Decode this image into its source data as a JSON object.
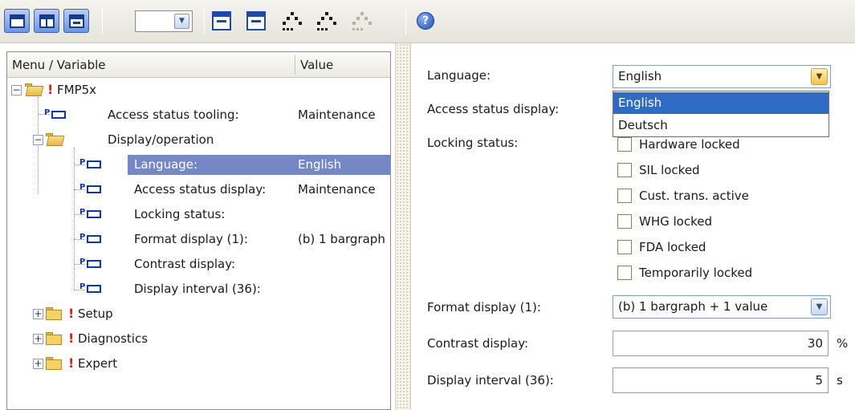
{
  "toolbar": {
    "buttons_left": [
      {
        "icon": "window-layout-icon"
      },
      {
        "icon": "window-split-icon"
      },
      {
        "icon": "window-panel-icon"
      }
    ],
    "combo_value": "",
    "icons_mid": [
      "window-icon",
      "window-icon",
      "network-icon",
      "network-icon",
      "network-disabled-icon"
    ],
    "help_glyph": "?"
  },
  "tree": {
    "columns": {
      "menu": "Menu / Variable",
      "value": "Value"
    },
    "rows": [
      {
        "label": "FMP5x",
        "value": "",
        "type": "folder-open",
        "warning": "!"
      },
      {
        "label": "Access status tooling:",
        "value": "Maintenance",
        "type": "param"
      },
      {
        "label": "Display/operation",
        "value": "",
        "type": "folder-open"
      },
      {
        "label": "Language:",
        "value": "English",
        "type": "param",
        "selected": true
      },
      {
        "label": "Access status display:",
        "value": "Maintenance",
        "type": "param"
      },
      {
        "label": "Locking status:",
        "value": "",
        "type": "param"
      },
      {
        "label": "Format display (1):",
        "value": "(b) 1 bargraph",
        "type": "param"
      },
      {
        "label": "Contrast display:",
        "value": "",
        "type": "param"
      },
      {
        "label": "Display interval (36):",
        "value": "",
        "type": "param"
      },
      {
        "label": "Setup",
        "value": "",
        "type": "folder-closed",
        "warning": "!"
      },
      {
        "label": "Diagnostics",
        "value": "",
        "type": "folder-closed",
        "warning": "!"
      },
      {
        "label": "Expert",
        "value": "",
        "type": "folder-closed",
        "warning": "!"
      }
    ]
  },
  "form": {
    "language": {
      "label": "Language:",
      "value": "English"
    },
    "language_options": [
      {
        "label": "English",
        "selected": true
      },
      {
        "label": "Deutsch",
        "selected": false
      }
    ],
    "access_status_display": {
      "label": "Access status display:"
    },
    "locking_status": {
      "label": "Locking status:",
      "items": [
        {
          "label": "Hardware locked",
          "checked": false
        },
        {
          "label": "SIL locked",
          "checked": false
        },
        {
          "label": "Cust. trans. active",
          "checked": false
        },
        {
          "label": "WHG locked",
          "checked": false
        },
        {
          "label": "FDA locked",
          "checked": false
        },
        {
          "label": "Temporarily locked",
          "checked": false
        }
      ]
    },
    "format_display": {
      "label": "Format display (1):",
      "value": "(b) 1 bargraph + 1 value"
    },
    "contrast_display": {
      "label": "Contrast display:",
      "value": "30",
      "unit": "%"
    },
    "display_interval": {
      "label": "Display interval (36):",
      "value": "5",
      "unit": "s"
    }
  },
  "colors": {
    "selection": "#7588c6",
    "dropdown_highlight": "#316ac5",
    "warning": "#e11b1b",
    "toolbar_button": "#6f95e0"
  }
}
